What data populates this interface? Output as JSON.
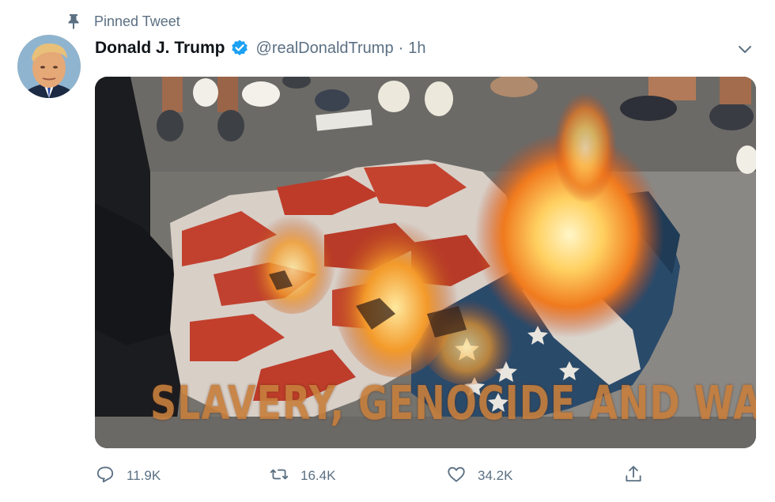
{
  "pinned": {
    "label": "Pinned Tweet",
    "icon": "pin-icon"
  },
  "author": {
    "display_name": "Donald J. Trump",
    "handle": "@realDonaldTrump",
    "separator": "·",
    "time": "1h",
    "verified_icon": "verified-badge-icon",
    "avatar_icon": "avatar"
  },
  "media": {
    "overlay_text": "SLAVERY, GENOCIDE AND WAR"
  },
  "actions": {
    "reply_count": "11.9K",
    "retweet_count": "16.4K",
    "like_count": "34.2K"
  },
  "colors": {
    "accent": "#1da1f2",
    "secondary_text": "#5b7083",
    "primary_text": "#0f1419"
  }
}
